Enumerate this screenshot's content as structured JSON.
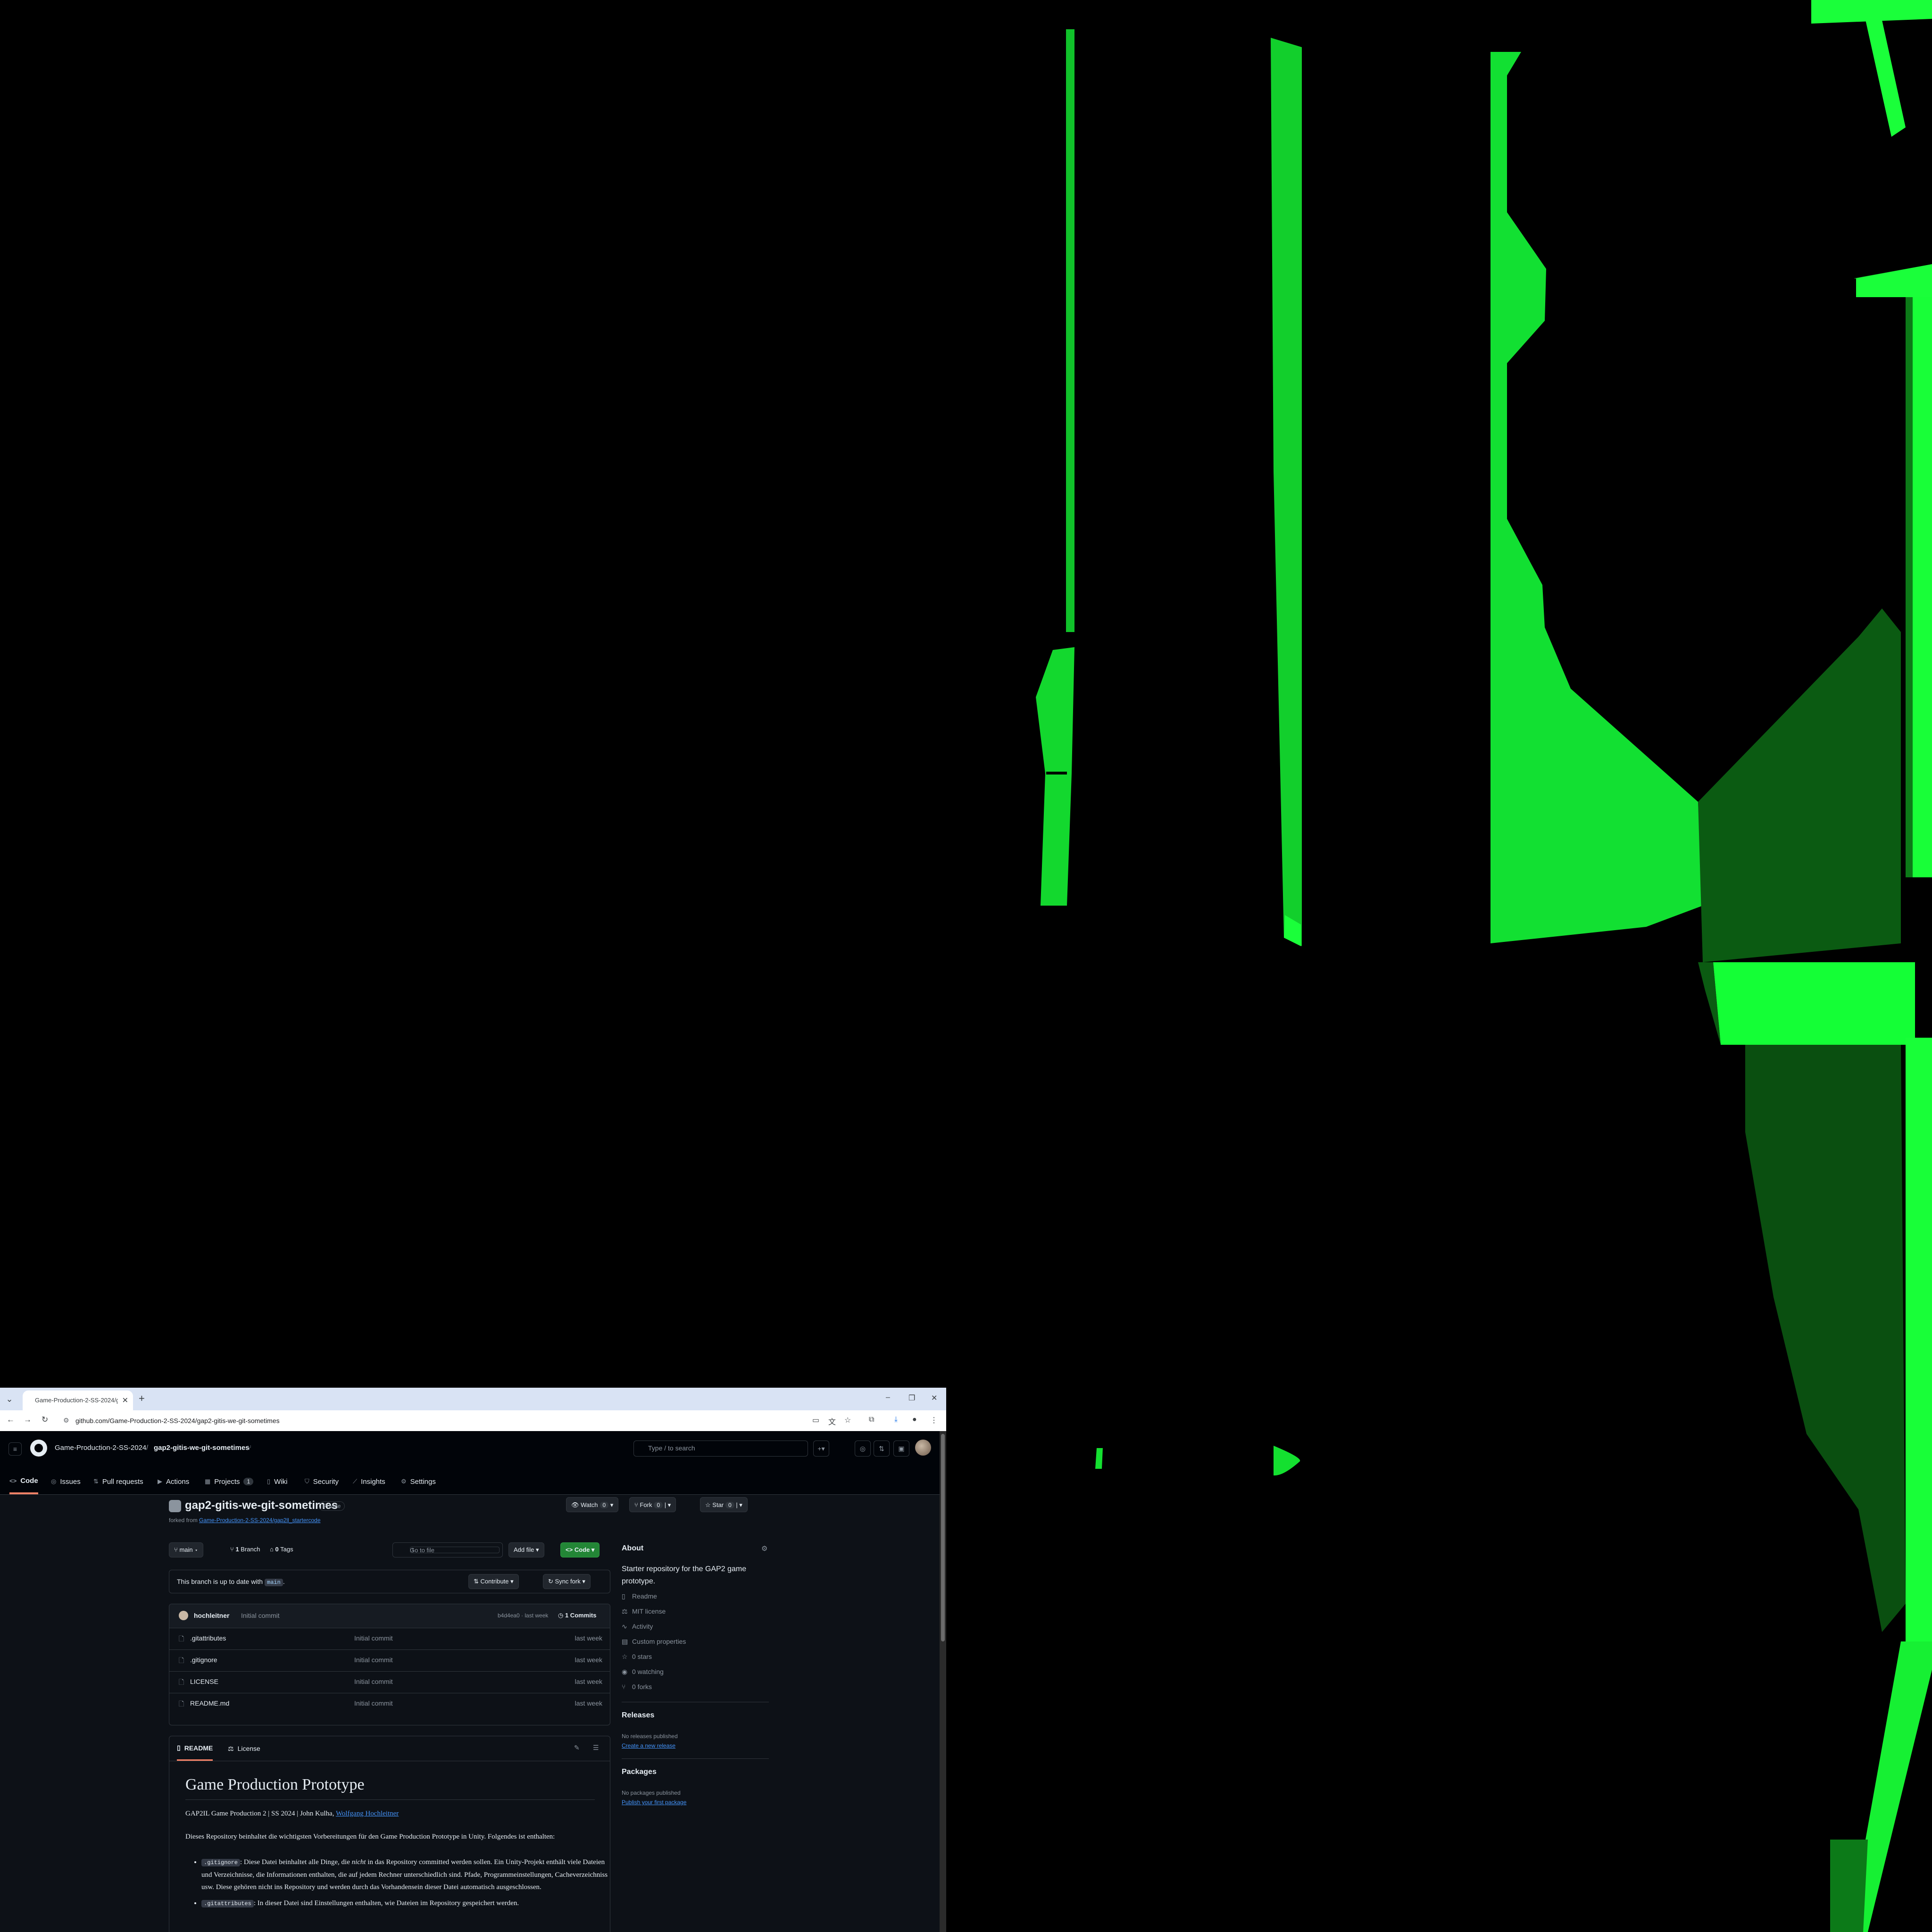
{
  "browser": {
    "tab_title": "Game-Production-2-SS-2024/g",
    "url": "github.com/Game-Production-2-SS-2024/gap2-gitis-we-git-sometimes"
  },
  "header": {
    "org": "Game-Production-2-SS-2024",
    "separator": "/",
    "repo": "gap2-gitis-we-git-sometimes",
    "search_placeholder": "Type / to search"
  },
  "repo_nav": [
    {
      "label": "Code"
    },
    {
      "label": "Issues"
    },
    {
      "label": "Pull requests"
    },
    {
      "label": "Actions"
    },
    {
      "label": "Projects",
      "count": "1"
    },
    {
      "label": "Wiki"
    },
    {
      "label": "Security"
    },
    {
      "label": "Insights"
    },
    {
      "label": "Settings"
    }
  ],
  "repo": {
    "name": "gap2-gitis-we-git-sometimes",
    "visibility": "Private",
    "forked_prefix": "forked from",
    "forked_from": "Game-Production-2-SS-2024/gap2ll_startercode",
    "watch_label": "Watch",
    "watch_count": "0",
    "fork_label": "Fork",
    "fork_count": "0",
    "star_label": "Star",
    "star_count": "0"
  },
  "toolbar": {
    "branch": "main",
    "branches_count": "1",
    "branches_label": "Branch",
    "tags_count": "0",
    "tags_label": "Tags",
    "gofile_placeholder": "Go to file",
    "gofile_key": "t",
    "add_file": "Add file",
    "code": "Code"
  },
  "sync": {
    "text_prefix": "This branch is up to date with",
    "branch": "main",
    "text_suffix": ".",
    "contribute": "Contribute",
    "sync_fork": "Sync fork"
  },
  "commit": {
    "author": "hochleitner",
    "message": "Initial commit",
    "hash_time": "b4d4ea0 · last week",
    "commits": "1 Commits"
  },
  "files": [
    {
      "name": ".gitattributes",
      "message": "Initial commit",
      "time": "last week"
    },
    {
      "name": ".gitignore",
      "message": "Initial commit",
      "time": "last week"
    },
    {
      "name": "LICENSE",
      "message": "Initial commit",
      "time": "last week"
    },
    {
      "name": "README.md",
      "message": "Initial commit",
      "time": "last week"
    }
  ],
  "readme": {
    "tab_readme": "README",
    "tab_license": "License",
    "title": "Game Production Prototype",
    "subtitle_prefix": "GAP2IL Game Production 2 | SS 2024 | John Kulha,",
    "subtitle_link": "Wolfgang Hochleitner",
    "intro": "Dieses Repository beinhaltet die wichtigsten Vorbereitungen für den Game Production Prototype in Unity. Folgendes ist enthalten:",
    "bullet1_code": ".gitignore",
    "bullet1_a": ": Diese Datei beinhaltet alle Dinge, die",
    "bullet1_em": "nicht",
    "bullet1_b": "in das Repository committed werden sollen. Ein Unity-Projekt enthält viele Dateien und Verzeichnisse, die Informationen enthalten, die auf jedem Rechner unterschiedlich sind. Pfade, Programmeinstellungen, Cacheverzeichniss usw. Diese gehören nicht ins Repository und werden durch das Vorhandensein dieser Datei automatisch ausgeschlossen.",
    "bullet2_code": ".gitattributes",
    "bullet2_text": ": In dieser Datei sind Einstellungen enthalten, wie Dateien im Repository gespeichert werden."
  },
  "about": {
    "heading": "About",
    "description": "Starter repository for the GAP2 game prototype.",
    "items": [
      {
        "icon": "book-icon",
        "label": "Readme"
      },
      {
        "icon": "scale-icon",
        "label": "MIT license"
      },
      {
        "icon": "pulse-icon",
        "label": "Activity"
      },
      {
        "icon": "properties-icon",
        "label": "Custom properties"
      },
      {
        "icon": "star-icon",
        "label": "0 stars"
      },
      {
        "icon": "eye-icon",
        "label": "0 watching"
      },
      {
        "icon": "fork-icon",
        "label": "0 forks"
      }
    ]
  },
  "releases": {
    "heading": "Releases",
    "empty": "No releases published",
    "link": "Create a new release"
  },
  "packages": {
    "heading": "Packages",
    "empty": "No packages published",
    "link": "Publish your first package"
  },
  "colors": {
    "background": "#000000",
    "neon_green": "#00ff33",
    "github_bg": "#0d1117",
    "accent_green": "#238636",
    "link_blue": "#4493f8"
  }
}
